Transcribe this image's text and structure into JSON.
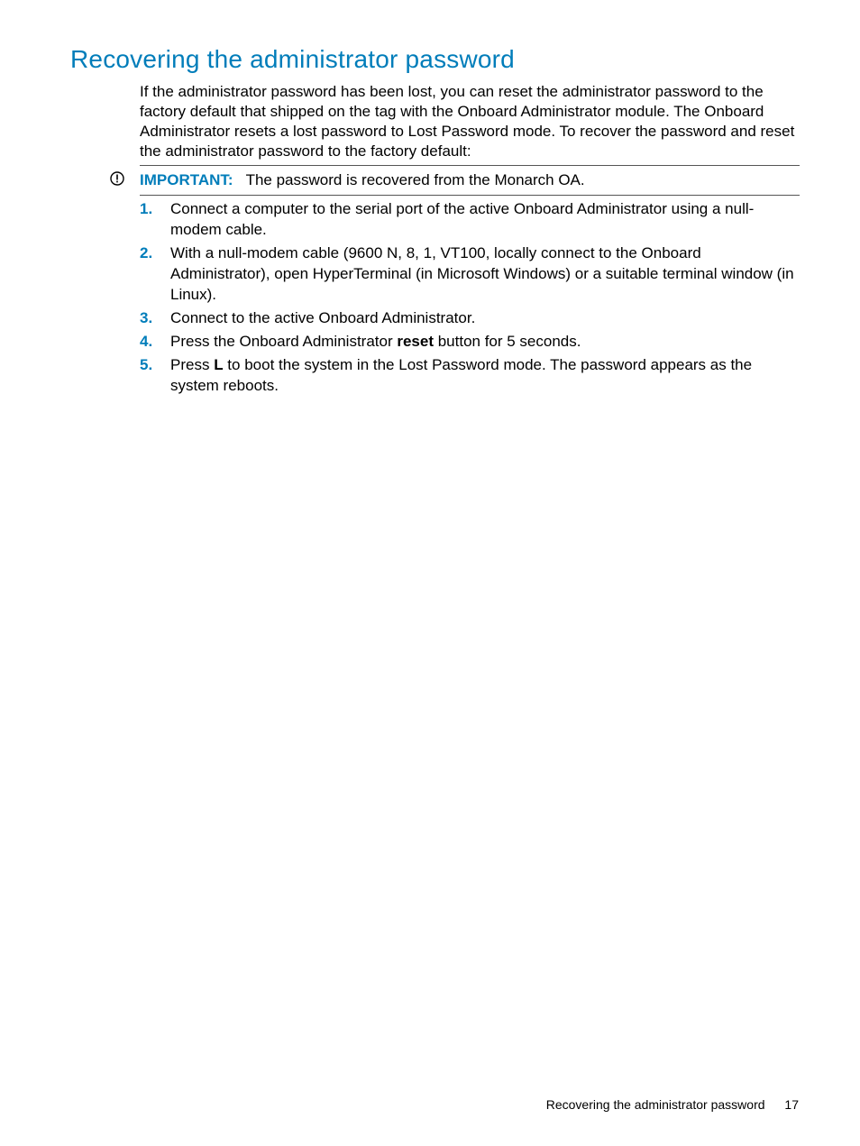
{
  "heading": "Recovering the administrator password",
  "intro": "If the administrator password has been lost, you can reset the administrator password to the factory default that shipped on the tag with the Onboard Administrator module. The Onboard Administrator resets a lost password to Lost Password mode. To recover the password and reset the administrator password to the factory default:",
  "callout": {
    "label": "IMPORTANT:",
    "text": "The password is recovered from the Monarch OA."
  },
  "steps": [
    {
      "num": "1.",
      "text": "Connect a computer to the serial port of the active Onboard Administrator using a null-modem cable."
    },
    {
      "num": "2.",
      "text": "With a null-modem cable (9600 N, 8, 1, VT100, locally connect to the Onboard Administrator), open HyperTerminal (in Microsoft Windows) or a suitable terminal window (in Linux)."
    },
    {
      "num": "3.",
      "text": "Connect to the active Onboard Administrator."
    },
    {
      "num": "4.",
      "pre": "Press the Onboard Administrator ",
      "bold": "reset",
      "post": " button for 5 seconds."
    },
    {
      "num": "5.",
      "pre": "Press ",
      "bold": "L",
      "post": " to boot the system in the Lost Password mode. The password appears as the system reboots."
    }
  ],
  "footer": {
    "title": "Recovering the administrator password",
    "page": "17"
  }
}
